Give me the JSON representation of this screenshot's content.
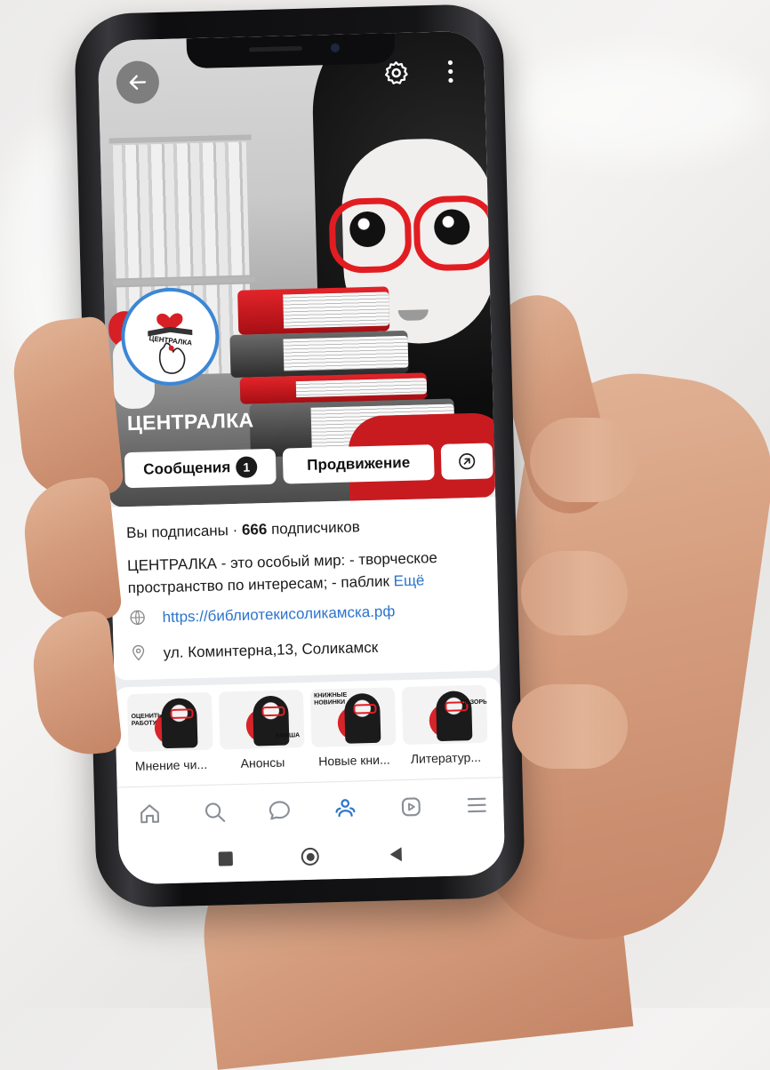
{
  "header": {
    "back_icon": "arrow-left-icon",
    "settings_icon": "gear-icon",
    "more_icon": "more-vertical-icon"
  },
  "group": {
    "name": "ЦЕНТРАЛКА",
    "avatar_text": "ЦЕНТРАЛКА"
  },
  "actions": {
    "messages_label": "Сообщения",
    "messages_count": "1",
    "promote_label": "Продвижение",
    "share_icon": "share-arrow-icon"
  },
  "info": {
    "subscribed": "Вы подписаны · ",
    "subscribers_count": "666",
    "subscribers_word": " подписчиков",
    "description": "ЦЕНТРАЛКА - это особый мир: - творческое",
    "description2": "пространство по интересам; - паблик ",
    "more_link": "Ещё",
    "website": "https://библиотекисоликамска.рф",
    "address": "ул. Коминтерна,13, Соликамск"
  },
  "stories": [
    {
      "label": "Мнение чи...",
      "tag": "ОЦЕНИТЬ\nРАБОТУ"
    },
    {
      "label": "Анонсы",
      "tag": "АФИША"
    },
    {
      "label": "Новые кни...",
      "tag": "КНИЖНЫЕ\nНОВИНКИ"
    },
    {
      "label": "Литератур...",
      "tag": "ОБЗОРЫ"
    }
  ],
  "nav": {
    "items": [
      "home-icon",
      "search-icon",
      "messages-icon",
      "communities-icon",
      "video-icon",
      "menu-icon"
    ],
    "active": "communities-icon",
    "accent": "#2b74cc"
  },
  "colors": {
    "brand_red": "#e21d22",
    "link_blue": "#2b74cc",
    "avatar_border": "#3b87d6"
  }
}
